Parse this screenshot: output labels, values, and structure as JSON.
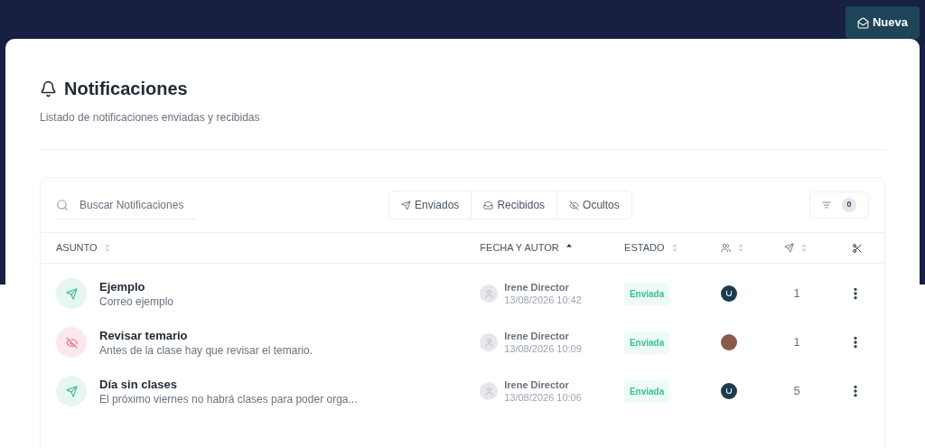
{
  "header": {
    "new_button": "Nueva"
  },
  "page": {
    "title": "Notificaciones",
    "subtitle": "Listado de notificaciones enviadas y recibidas"
  },
  "toolbar": {
    "search": {
      "placeholder": "Buscar Notificaciones"
    },
    "filters": [
      {
        "label": "Enviados",
        "kind": "sent",
        "selected": false
      },
      {
        "label": "Recibidos",
        "kind": "inbox",
        "selected": false
      },
      {
        "label": "Ocultos",
        "kind": "hidden",
        "selected": false
      }
    ],
    "filter_count": "0"
  },
  "table": {
    "columns": [
      {
        "kind": "text",
        "label": "ASUNTO",
        "sorted": false
      },
      {
        "kind": "text",
        "label": "FECHA Y AUTOR",
        "sorted": true
      },
      {
        "kind": "text",
        "label": "ESTADO",
        "sorted": false
      },
      {
        "kind": "recipients",
        "sorted": false
      },
      {
        "kind": "sent",
        "sorted": false
      },
      {
        "kind": "tools"
      }
    ],
    "rows": [
      {
        "kind": "sent",
        "title": "Ejemplo",
        "body": "Correo ejemplo",
        "author": "Irene Director",
        "date": "13/08/2026 10:42",
        "status": "Enviada",
        "recipient": {
          "kind": "logo"
        },
        "count": "1"
      },
      {
        "kind": "hidden",
        "title": "Revisar temario",
        "body": "Antes de la clase hay que revisar el temario.",
        "author": "Irene Director",
        "date": "13/08/2026 10:09",
        "status": "Enviada",
        "recipient": {
          "kind": "person"
        },
        "count": "1"
      },
      {
        "kind": "sent",
        "title": "Día sin clases",
        "body": "El próximo viernes no habrá clases para poder orga...",
        "author": "Irene Director",
        "date": "13/08/2026 10:06",
        "status": "Enviada",
        "recipient": {
          "kind": "logo"
        },
        "count": "5"
      }
    ]
  }
}
